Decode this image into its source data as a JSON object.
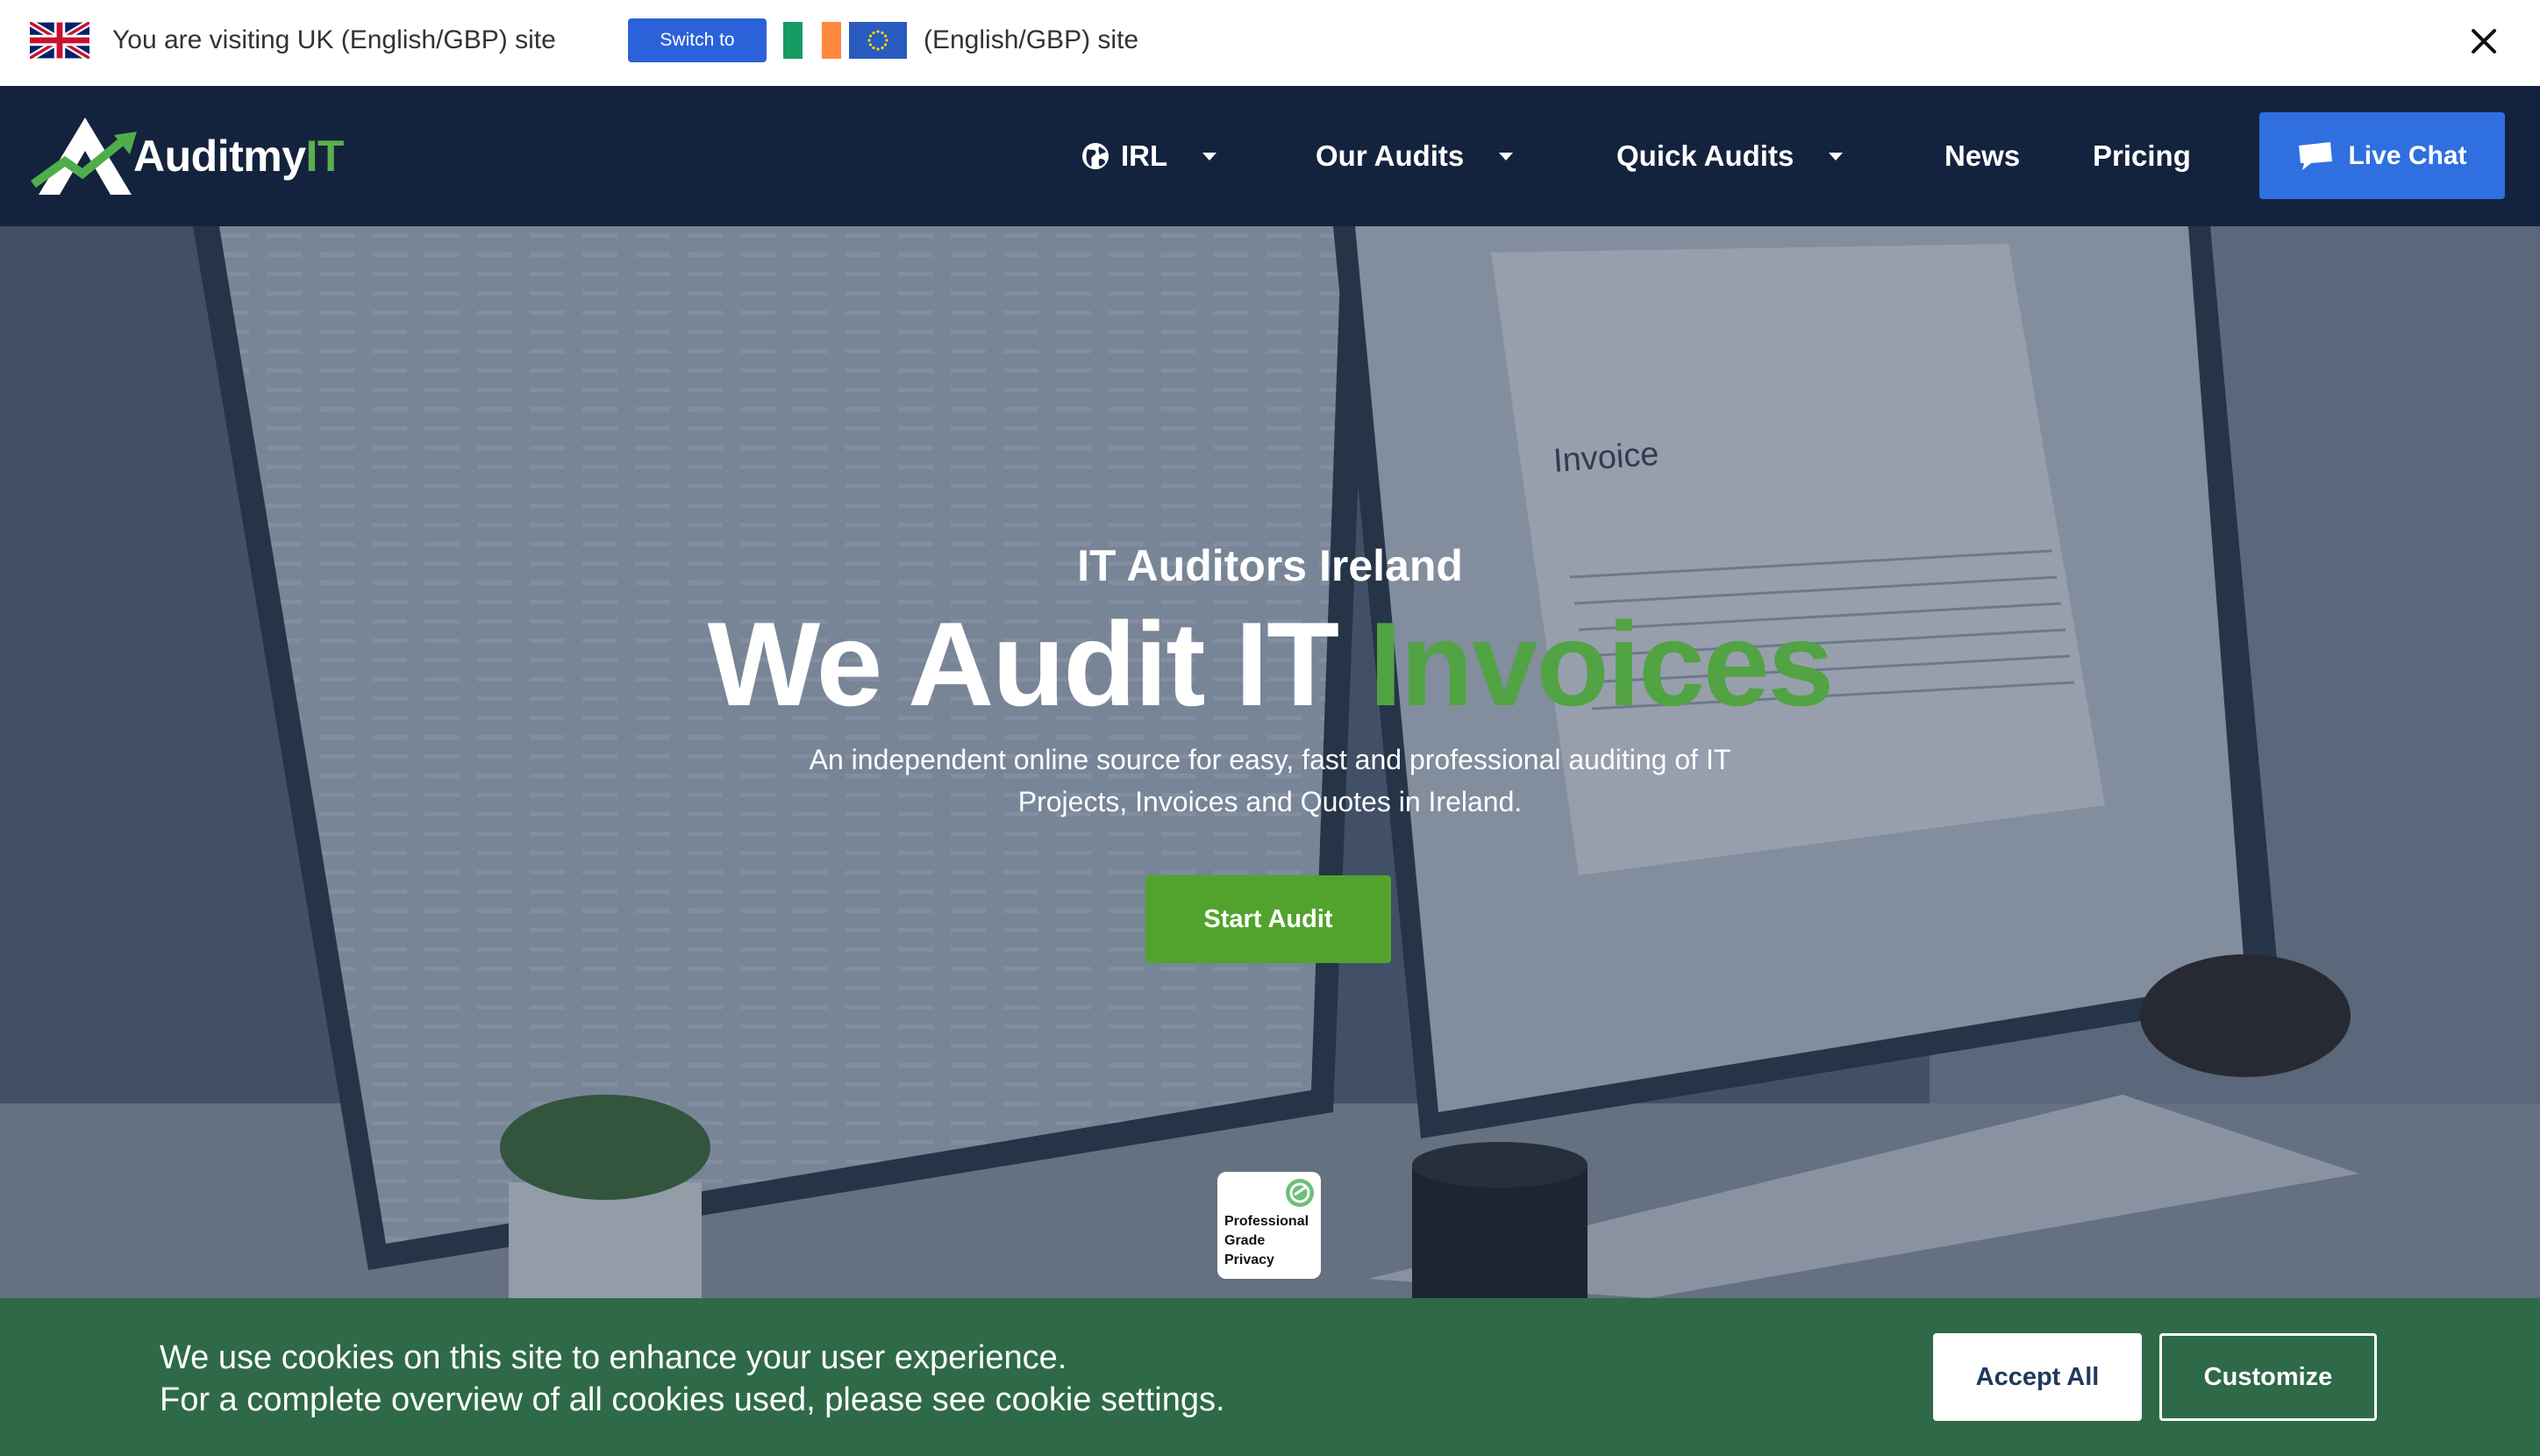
{
  "locale_bar": {
    "current_text": "You are visiting UK (English/GBP) site",
    "switch_label": "Switch to",
    "target_text": "(English/GBP) site",
    "icons": [
      "uk-flag-icon",
      "ireland-flag-icon",
      "eu-flag-icon",
      "close-icon"
    ]
  },
  "nav": {
    "logo": {
      "text_main": "Auditmy",
      "text_accent": "IT"
    },
    "items": [
      {
        "label": "IRL",
        "icon": "globe-icon",
        "dropdown": true
      },
      {
        "label": "Our Audits",
        "dropdown": true
      },
      {
        "label": "Quick Audits",
        "dropdown": true
      },
      {
        "label": "News",
        "dropdown": false
      },
      {
        "label": "Pricing",
        "dropdown": false
      }
    ],
    "live_chat_label": "Live Chat"
  },
  "hero": {
    "kicker": "IT Auditors Ireland",
    "title_main": "We Audit IT ",
    "title_accent": "Invoices",
    "subtitle": "An independent online source for easy, fast and professional auditing of IT Projects, Invoices and Quotes in Ireland.",
    "cta_label": "Start Audit",
    "badge_lines": [
      "Professional",
      "Grade",
      "Privacy"
    ],
    "background_doc_title": "Invoice"
  },
  "cookie_banner": {
    "line1": "We use cookies on this site to enhance your user experience.",
    "line2": "For a complete overview of all cookies used, please see cookie settings.",
    "accept_label": "Accept All",
    "customize_label": "Customize"
  },
  "colors": {
    "nav_bg": "#14233d",
    "accent_green": "#52a344",
    "cta_green": "#52a32d",
    "live_chat_blue": "#2f6fe0",
    "switch_blue": "#2b62d9",
    "cookie_bg": "#2e6a48"
  }
}
